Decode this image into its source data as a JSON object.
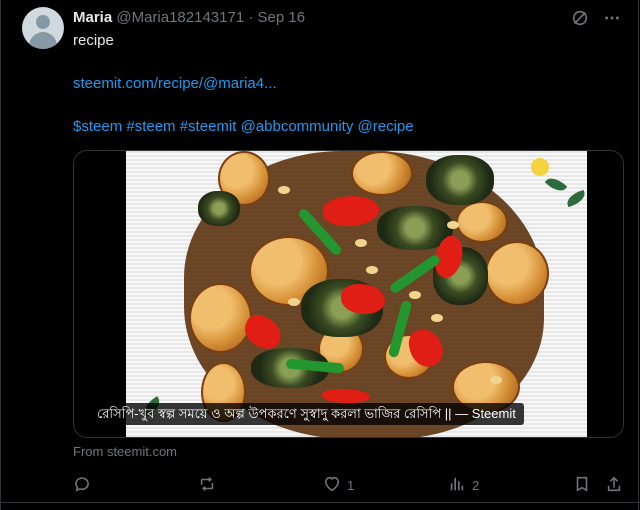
{
  "author": {
    "name": "Maria",
    "handle": "@Maria182143171",
    "date": "Sep 16"
  },
  "tweet": {
    "text": "recipe",
    "link": "steemit.com/recipe/@maria4...",
    "tags": "$steem #steem #steemit @abbcommunity @recipe"
  },
  "media": {
    "caption": "রেসিপি-খুব স্বল্প সময়ে ও অল্প উপকরণে সুস্বাদু করলা ভাজির রেসিপি || — Steemit"
  },
  "source": {
    "text": "From steemit.com"
  },
  "actions": {
    "likes": "1",
    "views": "2"
  },
  "icons": [
    "grok-icon",
    "more-icon",
    "reply-icon",
    "retweet-icon",
    "like-icon",
    "views-icon",
    "bookmark-icon",
    "share-icon"
  ],
  "colors": {
    "background": "#000000",
    "text": "#e7e9ea",
    "muted": "#71767b",
    "link": "#1d9bf0"
  }
}
